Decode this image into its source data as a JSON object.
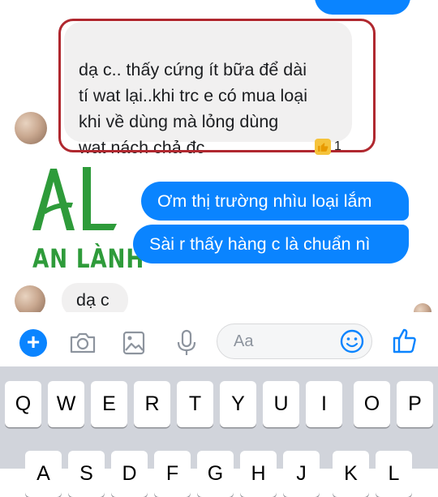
{
  "messages": {
    "incoming_1": "dạ c.. thấy cứng ít bữa để dài\ntí wat lại..khi trc e có mua loại\nkhi về dùng mà lỏng dùng\nwat nách chả đc",
    "incoming_1_reaction_count": "1",
    "outgoing_1": "Ơm thị trường nhìu loại lắm",
    "outgoing_2": "Sài r thấy hàng c là chuẩn nì",
    "incoming_2": "dạ c"
  },
  "logo": {
    "text": "AN LÀNH",
    "brand_color": "#2e9b3a"
  },
  "composer": {
    "placeholder": "Aa",
    "icons": [
      "plus-icon",
      "camera-icon",
      "image-icon",
      "microphone-icon",
      "emoji-icon",
      "thumbs-up-icon"
    ]
  },
  "keyboard": {
    "row1": [
      "Q",
      "W",
      "E",
      "R",
      "T",
      "Y",
      "U",
      "I",
      "O",
      "P"
    ],
    "row2": [
      "A",
      "S",
      "D",
      "F",
      "G",
      "H",
      "J",
      "K",
      "L"
    ]
  },
  "colors": {
    "messenger_blue": "#0a84ff",
    "incoming_bubble": "#f1f0f0",
    "highlight_border": "#b0282f",
    "keyboard_bg": "#d1d4db"
  }
}
